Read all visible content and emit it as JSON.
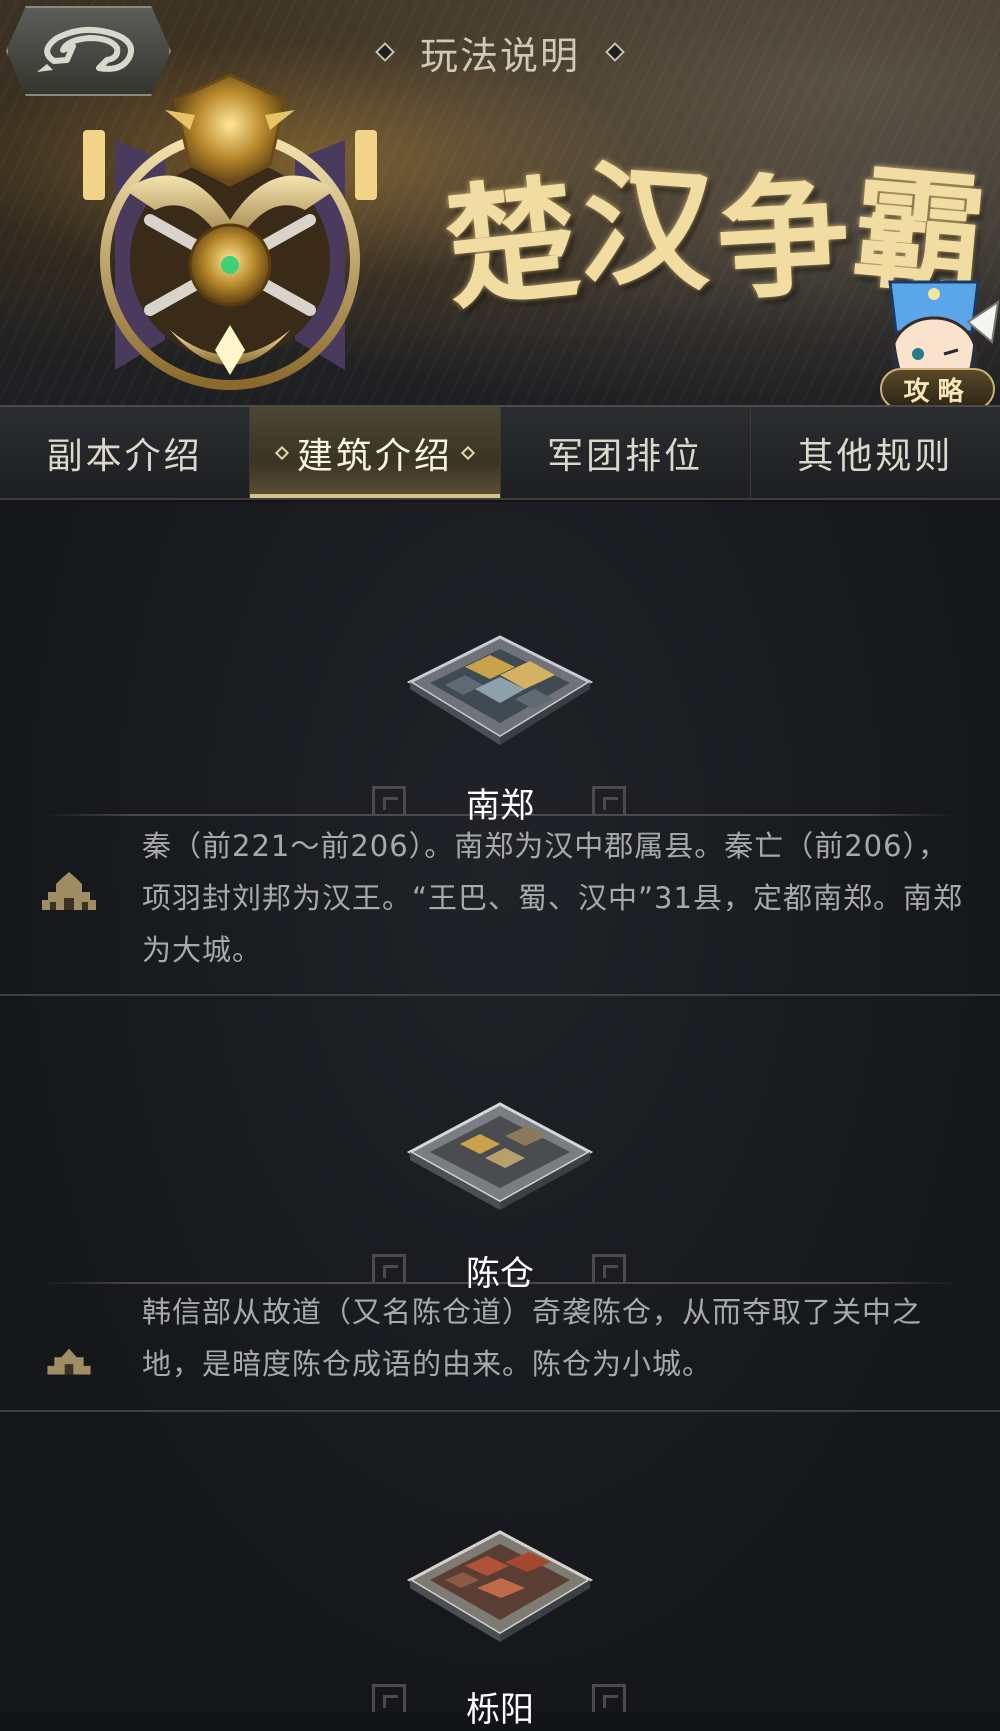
{
  "header": {
    "title": "玩法说明",
    "banner_text": [
      "楚",
      "汉",
      "争",
      "霸"
    ],
    "guide_label": "攻略"
  },
  "tabs": [
    {
      "label": "副本介绍",
      "active": false
    },
    {
      "label": "建筑介绍",
      "active": true
    },
    {
      "label": "军团排位",
      "active": false
    },
    {
      "label": "其他规则",
      "active": false
    }
  ],
  "buildings": [
    {
      "name": "南郑",
      "size_icon": "large-city-icon",
      "description": "秦（前221～前206）。南郑为汉中郡属县。秦亡（前206），项羽封刘邦为汉王。“王巴、蜀、汉中”31县，定都南郑。南郑为大城。"
    },
    {
      "name": "陈仓",
      "size_icon": "small-city-icon",
      "description": "韩信部从故道（又名陈仓道）奇袭陈仓，从而夺取了关中之地，是暗度陈仓成语的由来。陈仓为小城。"
    },
    {
      "name": "栎阳",
      "size_icon": "city-icon",
      "description": ""
    }
  ],
  "colors": {
    "accent_gold": "#d8c48a",
    "text_light": "#dcd8cc",
    "desc_text": "#a8a9ad",
    "background": "#121418"
  }
}
